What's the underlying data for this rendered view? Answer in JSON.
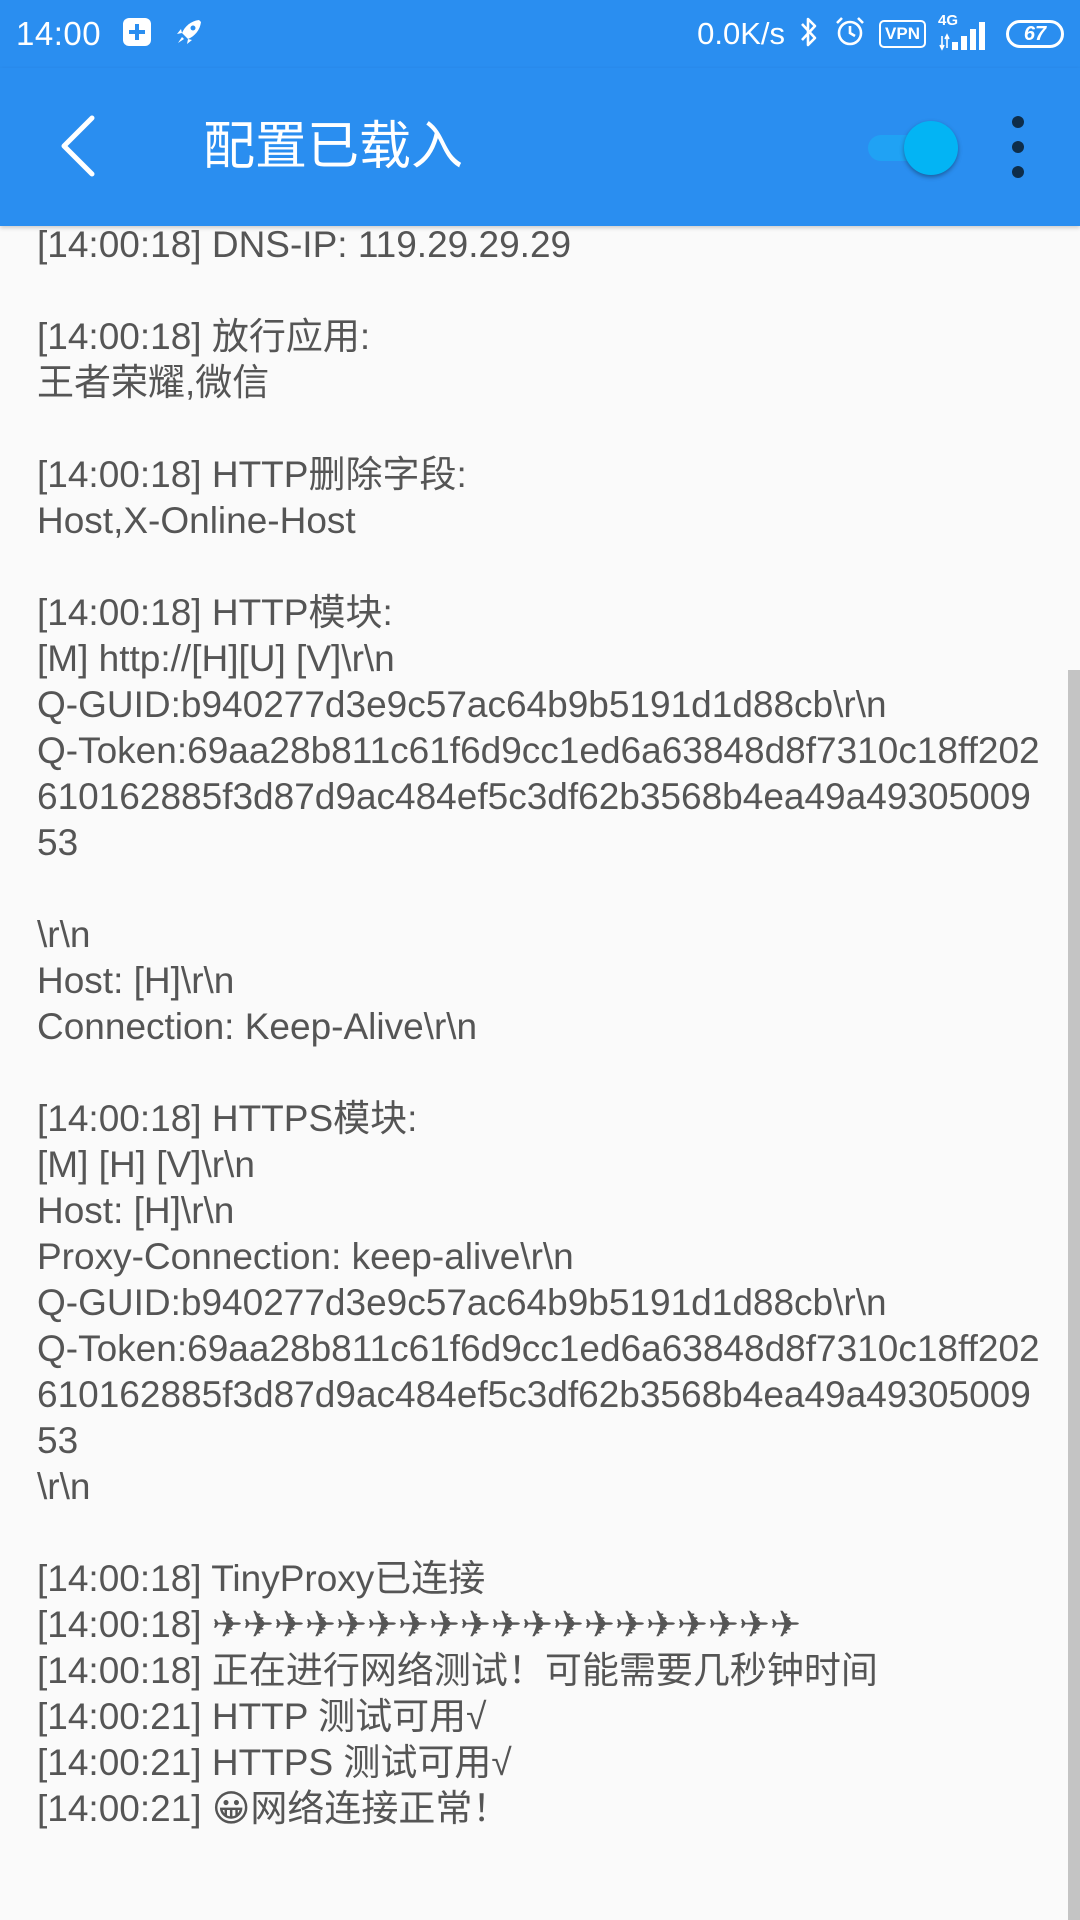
{
  "status_bar": {
    "time": "14:00",
    "net_speed": "0.0K/s",
    "vpn_label": "VPN",
    "network_type": "4G",
    "battery_level": "67",
    "icons": [
      "plus-square-icon",
      "rocket-icon",
      "bluetooth-icon",
      "alarm-icon",
      "vpn-icon",
      "signal-icon",
      "battery-icon"
    ]
  },
  "app_bar": {
    "title": "配置已载入",
    "toggle_on": true,
    "colors": {
      "background": "#2a8ef0",
      "toggle": "#03b4f4"
    }
  },
  "log": {
    "text": "[14:00:18] DNS-IP: 119.29.29.29\n\n[14:00:18] 放行应用:\n王者荣耀,微信\n\n[14:00:18] HTTP删除字段:\nHost,X-Online-Host\n\n[14:00:18] HTTP模块:\n[M] http://[H][U] [V]\\r\\n\nQ-GUID:b940277d3e9c57ac64b9b5191d1d88cb\\r\\n\nQ-Token:69aa28b811c61f6d9cc1ed6a63848d8f7310c18ff202610162885f3d87d9ac484ef5c3df62b3568b4ea49a4930500953\n\n\\r\\n\nHost: [H]\\r\\n\nConnection: Keep-Alive\\r\\n\n\n[14:00:18] HTTPS模块:\n[M] [H] [V]\\r\\n\nHost: [H]\\r\\n\nProxy-Connection: keep-alive\\r\\n\nQ-GUID:b940277d3e9c57ac64b9b5191d1d88cb\\r\\n\nQ-Token:69aa28b811c61f6d9cc1ed6a63848d8f7310c18ff202610162885f3d87d9ac484ef5c3df62b3568b4ea49a4930500953\n\\r\\n\n\n[14:00:18] TinyProxy已连接\n[14:00:18] ✈✈✈✈✈✈✈✈✈✈✈✈✈✈✈✈✈✈✈\n[14:00:18] 正在进行网络测试！可能需要几秒钟时间\n[14:00:21] HTTP 测试可用√\n[14:00:21] HTTPS 测试可用√\n[14:00:21] 😀网络连接正常！"
  }
}
